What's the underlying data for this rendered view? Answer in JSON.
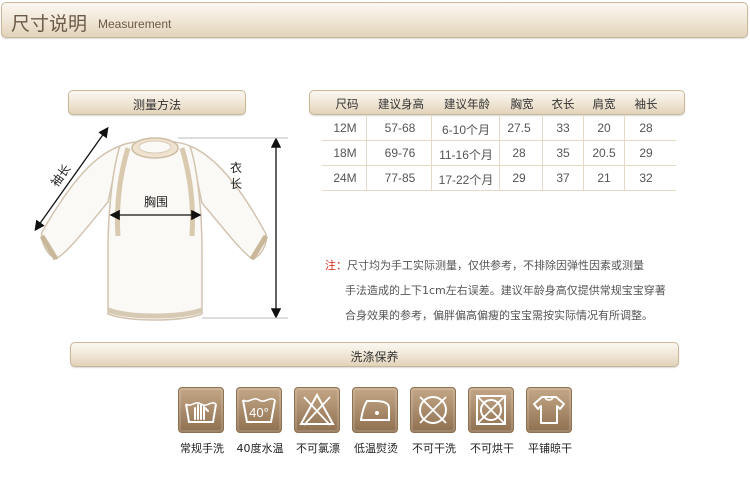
{
  "header": {
    "title": "尺寸说明",
    "subtitle": "Measurement"
  },
  "measure_method": {
    "label": "测量方法"
  },
  "diagram_labels": {
    "sleeve": "袖长",
    "length": "衣长",
    "chest": "胸围"
  },
  "size_table": {
    "headers": [
      "尺码",
      "建议身高",
      "建议年龄",
      "胸宽",
      "衣长",
      "肩宽",
      "袖长"
    ],
    "rows": [
      [
        "12M",
        "57-68",
        "6-10个月",
        "27.5",
        "33",
        "20",
        "28"
      ],
      [
        "18M",
        "69-76",
        "11-16个月",
        "28",
        "35",
        "20.5",
        "29"
      ],
      [
        "24M",
        "77-85",
        "17-22个月",
        "29",
        "37",
        "21",
        "32"
      ]
    ]
  },
  "note": {
    "prefix": "注：",
    "line1": "尺寸均为手工实际测量，仅供参考，不排除因弹性因素或测量",
    "line2": "手法造成的上下1cm左右误差。建议年龄身高仅提供常规宝宝穿著",
    "line3": "合身效果的参考，偏胖偏高偏瘦的宝宝需按实际情况有所调整。"
  },
  "care": {
    "label": "洗涤保养",
    "items": [
      {
        "icon": "hand-wash-icon",
        "label": "常规手洗"
      },
      {
        "icon": "wash-40-icon",
        "text": "40°",
        "label": "40度水温"
      },
      {
        "icon": "no-bleach-icon",
        "label": "不可氯漂"
      },
      {
        "icon": "low-iron-icon",
        "label": "低温熨烫"
      },
      {
        "icon": "no-dry-clean-icon",
        "label": "不可干洗"
      },
      {
        "icon": "no-tumble-dry-icon",
        "label": "不可烘干"
      },
      {
        "icon": "dry-flat-icon",
        "label": "平铺晾干"
      }
    ]
  },
  "colors": {
    "accent_red": "#d42c1c",
    "bar_border": "#c9b79a",
    "icon_brown": "#8f7152"
  }
}
